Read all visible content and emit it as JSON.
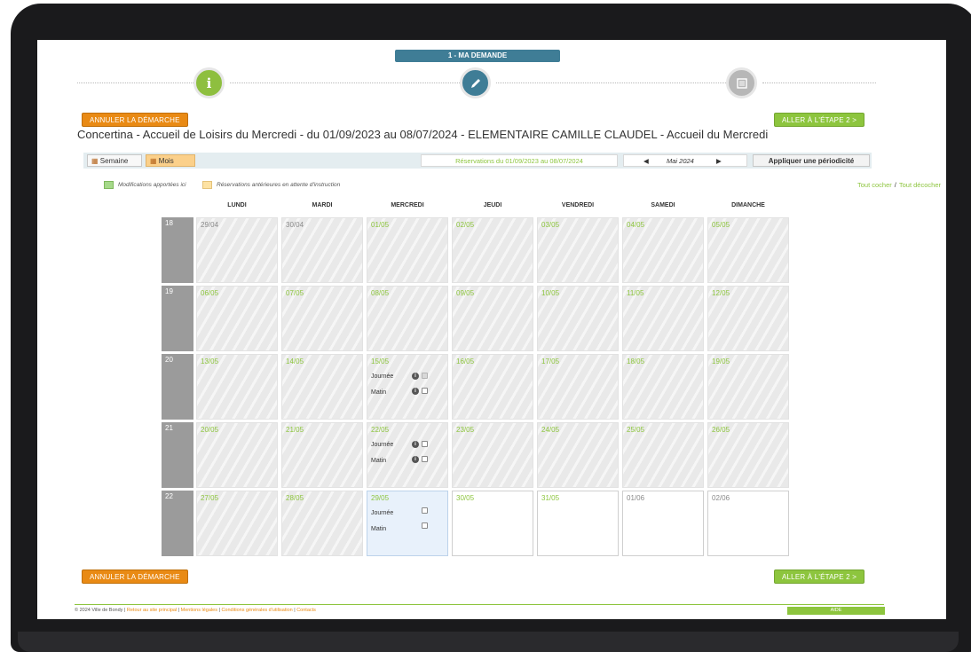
{
  "steps": {
    "current_label": "1 - MA DEMANDE",
    "icons": [
      "info-icon",
      "pencil-icon",
      "list-icon"
    ]
  },
  "actions": {
    "cancel_label": "ANNULER LA DÉMARCHE",
    "next_label": "ALLER À L'ÉTAPE 2 >"
  },
  "page_title": "Concertina - Accueil de Loisirs du Mercredi - du 01/09/2023 au 08/07/2024 - ELEMENTAIRE CAMILLE CLAUDEL - Accueil du Mercredi",
  "toolbar": {
    "week_label": "Semaine",
    "month_label": "Mois",
    "range_label": "Réservations du 01/09/2023 au 08/07/2024",
    "prev_symbol": "◀",
    "current_month": "Mai 2024",
    "next_symbol": "▶",
    "apply_label": "Appliquer une périodicité"
  },
  "legend": {
    "modified": "Modifications apportées ici",
    "pending": "Réservations antérieures en attente d'instruction"
  },
  "check_links": {
    "check_all": "Tout cocher",
    "separator": "/",
    "uncheck_all": "Tout décocher"
  },
  "calendar": {
    "days": [
      "LUNDI",
      "MARDI",
      "MERCREDI",
      "JEUDI",
      "VENDREDI",
      "SAMEDI",
      "DIMANCHE"
    ],
    "weeks": [
      {
        "number": "18",
        "dates": [
          "29/04",
          "30/04",
          "01/05",
          "02/05",
          "03/05",
          "04/05",
          "05/05"
        ]
      },
      {
        "number": "19",
        "dates": [
          "06/05",
          "07/05",
          "08/05",
          "09/05",
          "10/05",
          "11/05",
          "12/05"
        ]
      },
      {
        "number": "20",
        "dates": [
          "13/05",
          "14/05",
          "15/05",
          "16/05",
          "17/05",
          "18/05",
          "19/05"
        ]
      },
      {
        "number": "21",
        "dates": [
          "20/05",
          "21/05",
          "22/05",
          "23/05",
          "24/05",
          "25/05",
          "26/05"
        ]
      },
      {
        "number": "22",
        "dates": [
          "27/05",
          "28/05",
          "29/05",
          "30/05",
          "31/05",
          "01/06",
          "02/06"
        ]
      }
    ],
    "slot_journee": "Journée",
    "slot_matin": "Matin"
  },
  "footer": {
    "copyright": "© 2024 Ville de Bondy |",
    "link_site": "Retour au site principal",
    "sep": "|",
    "link_legal": "Mentions légales",
    "link_cgu": "Conditions générales d'utilisation",
    "link_contact": "Contacts",
    "aide_label": "AIDE"
  },
  "colors": {
    "accent_blue": "#3f7d96",
    "accent_green": "#8dc53e",
    "accent_orange": "#e98a14"
  }
}
